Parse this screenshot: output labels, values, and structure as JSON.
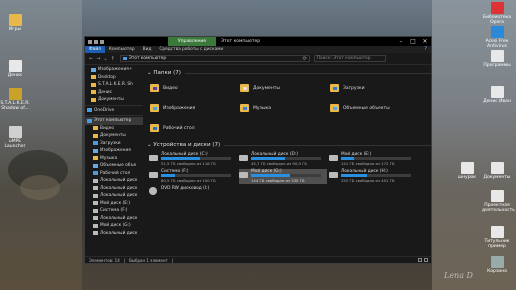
{
  "desktop": {
    "left_icons": [
      {
        "label": "Игры",
        "color": "#e8b84a"
      },
      {
        "label": "Денис",
        "color": "#e8e8e8"
      },
      {
        "label": "S.T.A.L.K.E.R. Shadow of...",
        "color": "#c9a227"
      },
      {
        "label": "uMPE Launcher",
        "color": "#d0d0d0"
      }
    ],
    "right_icons": [
      {
        "label": "Библиотека Opera",
        "color": "#d33"
      },
      {
        "label": "Acesi Free Antivirus",
        "color": "#2a8ad8"
      },
      {
        "label": "Программы",
        "color": "#e8e8e8"
      },
      {
        "label": "Денис Иван",
        "color": "#e8e8e8"
      },
      {
        "label": "шнурок",
        "color": "#e8e8e8"
      },
      {
        "label": "Документы",
        "color": "#e8e8e8"
      },
      {
        "label": "Проектная деятельность",
        "color": "#e8e8e8"
      },
      {
        "label": "Титульник пример",
        "color": "#e8e8e8"
      },
      {
        "label": "Корзина",
        "color": "#9aa"
      }
    ],
    "watermark": "Lena D"
  },
  "window": {
    "context_tab": "Управление",
    "title": "Этот компьютер",
    "ribbon_tabs": [
      "Файл",
      "Компьютер",
      "Вид",
      "Средства работы с дисками"
    ],
    "address": "Этот компьютер",
    "search_placeholder": "Поиск: Этот компьютер",
    "nav_items": [
      {
        "label": "Изображения",
        "color": "#6aa9e0",
        "pin": true
      },
      {
        "label": "Desktop",
        "color": "#e8b84a",
        "pin": false
      },
      {
        "label": "S.T.A.L.K.E.R. Sh",
        "color": "#e8b84a",
        "pin": false
      },
      {
        "label": "Денис",
        "color": "#e8b84a",
        "pin": false
      },
      {
        "label": "Документы",
        "color": "#e8b84a",
        "pin": false
      },
      {
        "label": "OneDrive",
        "color": "#4a9be0",
        "pin": false
      },
      {
        "label": "Этот компьютер",
        "color": "#4a9be0",
        "pin": false
      },
      {
        "label": "Видео",
        "color": "#e8b84a",
        "pin": false
      },
      {
        "label": "Документы",
        "color": "#e8b84a",
        "pin": false
      },
      {
        "label": "Загрузки",
        "color": "#4a9be0",
        "pin": false
      },
      {
        "label": "Изображения",
        "color": "#6aa9e0",
        "pin": false
      },
      {
        "label": "Музыка",
        "color": "#e8b84a",
        "pin": false
      },
      {
        "label": "Объемные объе",
        "color": "#6aa9e0",
        "pin": false
      },
      {
        "label": "Рабочий стол",
        "color": "#4a9be0",
        "pin": false
      },
      {
        "label": "Локальный диск",
        "color": "#bbb",
        "pin": false
      },
      {
        "label": "Локальный диск",
        "color": "#bbb",
        "pin": false
      },
      {
        "label": "Локальный диск",
        "color": "#bbb",
        "pin": false
      },
      {
        "label": "Мой диск (E:)",
        "color": "#bbb",
        "pin": false
      },
      {
        "label": "Система (F:)",
        "color": "#bbb",
        "pin": false
      },
      {
        "label": "Локальный диск",
        "color": "#bbb",
        "pin": false
      },
      {
        "label": "Мой диск (G:)",
        "color": "#bbb",
        "pin": false
      },
      {
        "label": "Локальный диск",
        "color": "#bbb",
        "pin": false
      }
    ],
    "folders_header": "Папки (7)",
    "folders": [
      {
        "label": "Видео",
        "badge": "#5b3fa8"
      },
      {
        "label": "Документы",
        "badge": "#e0e0e0"
      },
      {
        "label": "Загрузки",
        "badge": "#2a7fd0"
      },
      {
        "label": "Изображения",
        "badge": "#4aa0e0"
      },
      {
        "label": "Музыка",
        "badge": "#3a7fd0"
      },
      {
        "label": "Объемные объекты",
        "badge": "#5aa8e0"
      },
      {
        "label": "Рабочий стол",
        "badge": "#2a6fc0"
      }
    ],
    "drives_header": "Устройства и диски (7)",
    "drives": [
      {
        "name": "Локальный диск (C:)",
        "free": "51,5 ГБ свободно из 118 ГБ",
        "used_fraction": 0.56,
        "selected": false
      },
      {
        "name": "Локальный диск (D:)",
        "free": "45,7 ГБ свободно из 90,0 ГБ",
        "used_fraction": 0.49,
        "selected": false
      },
      {
        "name": "Мой диск (E:)",
        "free": "141 ГБ свободно из 172 ГБ",
        "used_fraction": 0.18,
        "selected": false
      },
      {
        "name": "Система (F:)",
        "free": "80,5 ГБ свободно из 100 ГБ",
        "used_fraction": 0.2,
        "selected": false
      },
      {
        "name": "Мой диск (G:)",
        "free": "144 ГБ свободно из 330 ГБ",
        "used_fraction": 0.56,
        "selected": true
      },
      {
        "name": "Локальный диск (H:)",
        "free": "252 ГБ свободно из 401 ГБ",
        "used_fraction": 0.37,
        "selected": false
      },
      {
        "name": "DVD RW дисковод (I:)",
        "free": "",
        "used_fraction": 0,
        "selected": false
      }
    ],
    "status_items": "Элементов: 14",
    "status_selected": "Выбран 1 элемент"
  }
}
